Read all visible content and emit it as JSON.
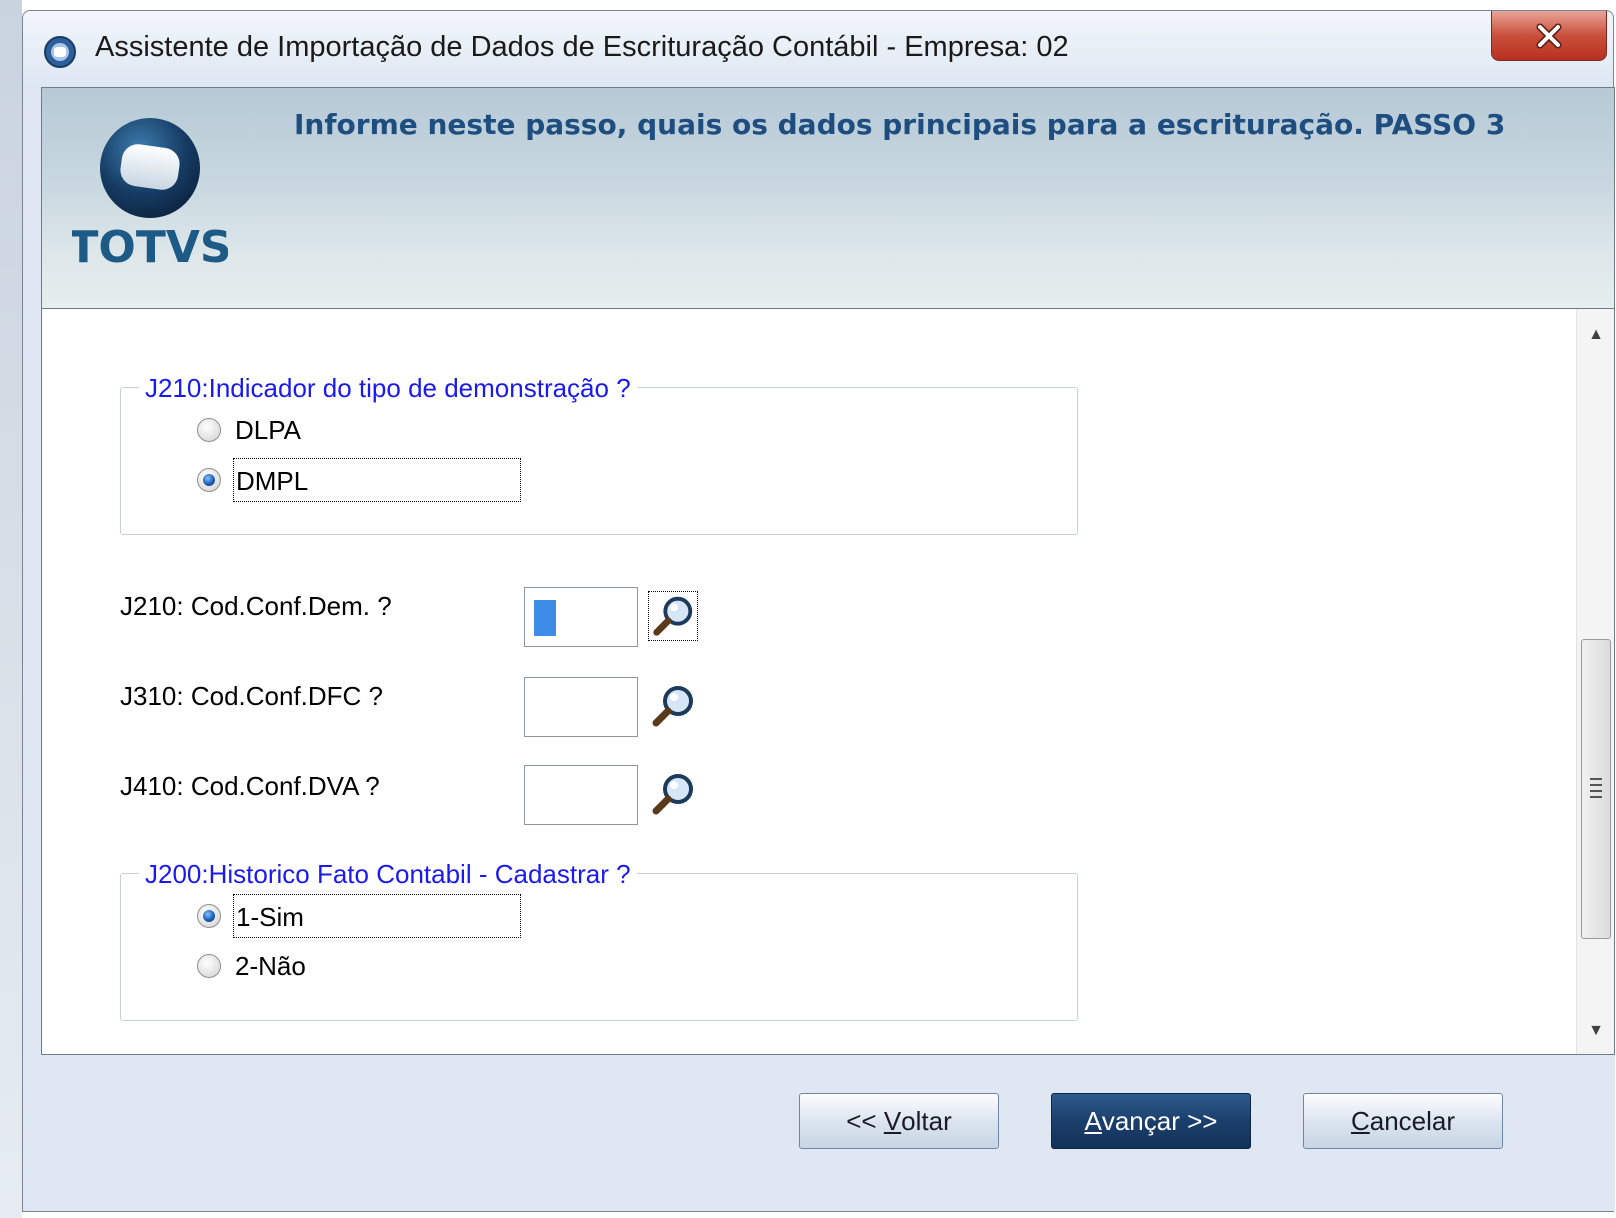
{
  "window": {
    "title": "Assistente de Importação de Dados de Escrituração Contábil - Empresa: 02",
    "close_label": "X"
  },
  "header": {
    "instruction": "Informe neste passo, quais os dados principais para a escrituração. PASSO 3",
    "logo_text": "TOTVS"
  },
  "group_demonstracao": {
    "legend": "J210:Indicador do tipo de demonstração ?",
    "options": [
      {
        "label": "DLPA",
        "checked": false
      },
      {
        "label": "DMPL",
        "checked": true
      }
    ]
  },
  "fields": [
    {
      "label": "J210: Cod.Conf.Dem.  ?",
      "value": ""
    },
    {
      "label": "J310: Cod.Conf.DFC ?",
      "value": ""
    },
    {
      "label": "J410: Cod.Conf.DVA ?",
      "value": ""
    }
  ],
  "group_historico": {
    "legend": "J200:Historico Fato Contabil - Cadastrar ?",
    "options": [
      {
        "label": "1-Sim",
        "checked": true
      },
      {
        "label": "2-Não",
        "checked": false
      }
    ]
  },
  "buttons": {
    "back": {
      "prefix": "<< ",
      "mnemonic": "V",
      "rest": "oltar"
    },
    "next": {
      "prefix": "",
      "mnemonic": "A",
      "rest": "vançar >>"
    },
    "cancel": {
      "prefix": "",
      "mnemonic": "C",
      "rest": "ancelar"
    }
  },
  "colors": {
    "legend_text": "#1a1aee",
    "header_text": "#1e4d80",
    "primary_button": "#1b3f6c",
    "logo": "#1d5a86"
  }
}
